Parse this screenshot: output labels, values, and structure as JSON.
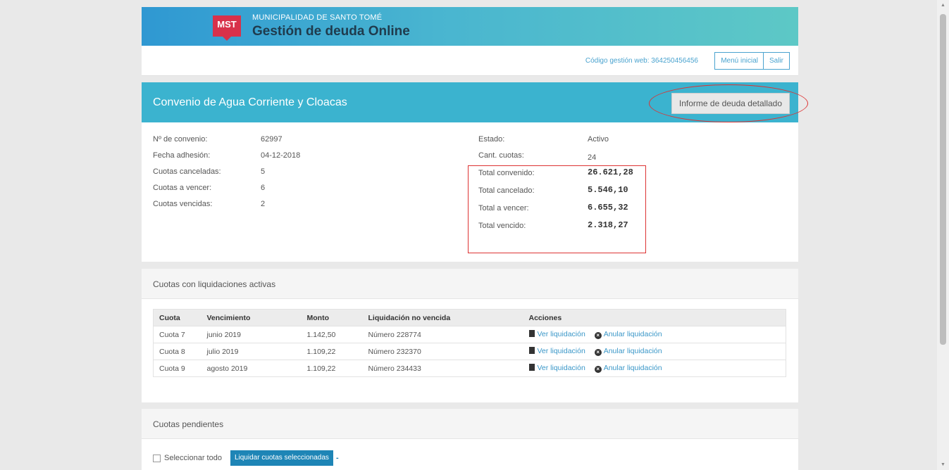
{
  "header": {
    "logo_text": "MST",
    "municipality": "MUNICIPALIDAD DE SANTO TOMÉ",
    "title": "Gestión de deuda Online"
  },
  "topbar": {
    "code_label": "Código gestión web: 364250456456",
    "menu_button": "Menú inicial",
    "exit_button": "Salir"
  },
  "convenio": {
    "title": "Convenio de Agua Corriente y Cloacas",
    "report_button": "Informe de deuda detallado",
    "left": [
      {
        "label": "Nº de convenio:",
        "value": "62997"
      },
      {
        "label": "Fecha adhesión:",
        "value": "04-12-2018"
      },
      {
        "label": "Cuotas canceladas:",
        "value": "5"
      },
      {
        "label": "Cuotas a vencer:",
        "value": "6"
      },
      {
        "label": "Cuotas vencidas:",
        "value": "2"
      }
    ],
    "right": [
      {
        "label": "Estado:",
        "value": "Activo"
      },
      {
        "label": "Cant. cuotas:",
        "value": "24"
      },
      {
        "label": "Total convenido:",
        "value": "26.621,28"
      },
      {
        "label": "Total cancelado:",
        "value": "5.546,10"
      },
      {
        "label": "Total a vencer:",
        "value": "6.655,32"
      },
      {
        "label": "Total vencido:",
        "value": "2.318,27"
      }
    ]
  },
  "liquidaciones": {
    "title": "Cuotas con liquidaciones activas",
    "columns": [
      "Cuota",
      "Vencimiento",
      "Monto",
      "Liquidación no vencida",
      "Acciones"
    ],
    "rows": [
      {
        "cuota": "Cuota 7",
        "vencimiento": "junio 2019",
        "monto": "1.142,50",
        "liquidacion": "Número 228774"
      },
      {
        "cuota": "Cuota 8",
        "vencimiento": "julio 2019",
        "monto": "1.109,22",
        "liquidacion": "Número 232370"
      },
      {
        "cuota": "Cuota 9",
        "vencimiento": "agosto 2019",
        "monto": "1.109,22",
        "liquidacion": "Número 234433"
      }
    ],
    "action_view": "Ver liquidación",
    "action_cancel": "Anular liquidación"
  },
  "pendientes": {
    "title": "Cuotas pendientes",
    "select_all": "Seleccionar todo",
    "liquidar_button": "Liquidar cuotas seleccionadas",
    "dash": "-"
  },
  "colors": {
    "accent": "#3bb3cf",
    "link": "#3a97c8",
    "primary_button": "#1e85b6",
    "highlight": "#dd3333"
  }
}
